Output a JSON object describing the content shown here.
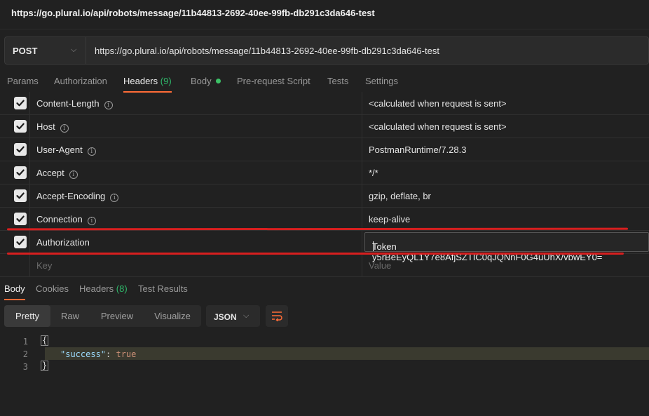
{
  "window": {
    "title": "https://go.plural.io/api/robots/message/11b44813-2692-40ee-99fb-db291c3da646-test"
  },
  "request": {
    "method": "POST",
    "url": "https://go.plural.io/api/robots/message/11b44813-2692-40ee-99fb-db291c3da646-test"
  },
  "request_tabs": {
    "params": "Params",
    "authorization": "Authorization",
    "headers": "Headers",
    "headers_count": "(9)",
    "body": "Body",
    "prerequest": "Pre-request Script",
    "tests": "Tests",
    "settings": "Settings"
  },
  "headers": [
    {
      "key": "Content-Length",
      "value": "<calculated when request is sent>",
      "checked": true,
      "info": true
    },
    {
      "key": "Host",
      "value": "<calculated when request is sent>",
      "checked": true,
      "info": true
    },
    {
      "key": "User-Agent",
      "value": "PostmanRuntime/7.28.3",
      "checked": true,
      "info": true
    },
    {
      "key": "Accept",
      "value": "*/*",
      "checked": true,
      "info": true
    },
    {
      "key": "Accept-Encoding",
      "value": "gzip, deflate, br",
      "checked": true,
      "info": true
    },
    {
      "key": "Connection",
      "value": "keep-alive",
      "checked": true,
      "info": true
    },
    {
      "key": "Authorization",
      "value": "Token y5rBeEyQL1Y7e8AfjSZTIC0qJQNnF0G4uUhX/vbwEY0=",
      "checked": true,
      "info": false
    }
  ],
  "new_header": {
    "key_placeholder": "Key",
    "value_placeholder": "Value"
  },
  "response_tabs": {
    "body": "Body",
    "cookies": "Cookies",
    "headers": "Headers",
    "headers_count": "(8)",
    "test_results": "Test Results"
  },
  "view_modes": {
    "pretty": "Pretty",
    "raw": "Raw",
    "preview": "Preview",
    "visualize": "Visualize"
  },
  "format": "JSON",
  "response_code": {
    "line_numbers": [
      "1",
      "2",
      "3"
    ],
    "open_brace": "{",
    "key": "\"success\"",
    "colon": ": ",
    "value": "true",
    "close_brace": "}"
  },
  "colors": {
    "accent": "#ff6c37",
    "highlight_red": "#d71f1f",
    "body_dot": "#3cc267"
  }
}
